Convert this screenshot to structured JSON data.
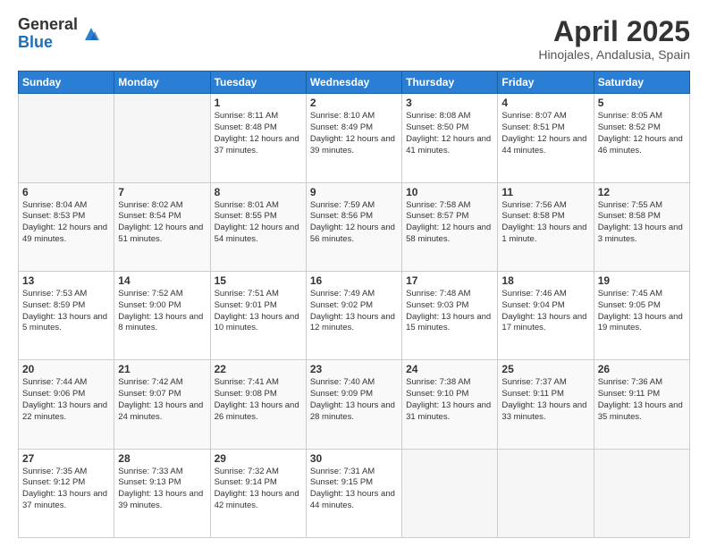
{
  "logo": {
    "general": "General",
    "blue": "Blue"
  },
  "header": {
    "title": "April 2025",
    "subtitle": "Hinojales, Andalusia, Spain"
  },
  "weekdays": [
    "Sunday",
    "Monday",
    "Tuesday",
    "Wednesday",
    "Thursday",
    "Friday",
    "Saturday"
  ],
  "weeks": [
    [
      {
        "day": "",
        "content": ""
      },
      {
        "day": "",
        "content": ""
      },
      {
        "day": "1",
        "content": "Sunrise: 8:11 AM\nSunset: 8:48 PM\nDaylight: 12 hours and 37 minutes."
      },
      {
        "day": "2",
        "content": "Sunrise: 8:10 AM\nSunset: 8:49 PM\nDaylight: 12 hours and 39 minutes."
      },
      {
        "day": "3",
        "content": "Sunrise: 8:08 AM\nSunset: 8:50 PM\nDaylight: 12 hours and 41 minutes."
      },
      {
        "day": "4",
        "content": "Sunrise: 8:07 AM\nSunset: 8:51 PM\nDaylight: 12 hours and 44 minutes."
      },
      {
        "day": "5",
        "content": "Sunrise: 8:05 AM\nSunset: 8:52 PM\nDaylight: 12 hours and 46 minutes."
      }
    ],
    [
      {
        "day": "6",
        "content": "Sunrise: 8:04 AM\nSunset: 8:53 PM\nDaylight: 12 hours and 49 minutes."
      },
      {
        "day": "7",
        "content": "Sunrise: 8:02 AM\nSunset: 8:54 PM\nDaylight: 12 hours and 51 minutes."
      },
      {
        "day": "8",
        "content": "Sunrise: 8:01 AM\nSunset: 8:55 PM\nDaylight: 12 hours and 54 minutes."
      },
      {
        "day": "9",
        "content": "Sunrise: 7:59 AM\nSunset: 8:56 PM\nDaylight: 12 hours and 56 minutes."
      },
      {
        "day": "10",
        "content": "Sunrise: 7:58 AM\nSunset: 8:57 PM\nDaylight: 12 hours and 58 minutes."
      },
      {
        "day": "11",
        "content": "Sunrise: 7:56 AM\nSunset: 8:58 PM\nDaylight: 13 hours and 1 minute."
      },
      {
        "day": "12",
        "content": "Sunrise: 7:55 AM\nSunset: 8:58 PM\nDaylight: 13 hours and 3 minutes."
      }
    ],
    [
      {
        "day": "13",
        "content": "Sunrise: 7:53 AM\nSunset: 8:59 PM\nDaylight: 13 hours and 5 minutes."
      },
      {
        "day": "14",
        "content": "Sunrise: 7:52 AM\nSunset: 9:00 PM\nDaylight: 13 hours and 8 minutes."
      },
      {
        "day": "15",
        "content": "Sunrise: 7:51 AM\nSunset: 9:01 PM\nDaylight: 13 hours and 10 minutes."
      },
      {
        "day": "16",
        "content": "Sunrise: 7:49 AM\nSunset: 9:02 PM\nDaylight: 13 hours and 12 minutes."
      },
      {
        "day": "17",
        "content": "Sunrise: 7:48 AM\nSunset: 9:03 PM\nDaylight: 13 hours and 15 minutes."
      },
      {
        "day": "18",
        "content": "Sunrise: 7:46 AM\nSunset: 9:04 PM\nDaylight: 13 hours and 17 minutes."
      },
      {
        "day": "19",
        "content": "Sunrise: 7:45 AM\nSunset: 9:05 PM\nDaylight: 13 hours and 19 minutes."
      }
    ],
    [
      {
        "day": "20",
        "content": "Sunrise: 7:44 AM\nSunset: 9:06 PM\nDaylight: 13 hours and 22 minutes."
      },
      {
        "day": "21",
        "content": "Sunrise: 7:42 AM\nSunset: 9:07 PM\nDaylight: 13 hours and 24 minutes."
      },
      {
        "day": "22",
        "content": "Sunrise: 7:41 AM\nSunset: 9:08 PM\nDaylight: 13 hours and 26 minutes."
      },
      {
        "day": "23",
        "content": "Sunrise: 7:40 AM\nSunset: 9:09 PM\nDaylight: 13 hours and 28 minutes."
      },
      {
        "day": "24",
        "content": "Sunrise: 7:38 AM\nSunset: 9:10 PM\nDaylight: 13 hours and 31 minutes."
      },
      {
        "day": "25",
        "content": "Sunrise: 7:37 AM\nSunset: 9:11 PM\nDaylight: 13 hours and 33 minutes."
      },
      {
        "day": "26",
        "content": "Sunrise: 7:36 AM\nSunset: 9:11 PM\nDaylight: 13 hours and 35 minutes."
      }
    ],
    [
      {
        "day": "27",
        "content": "Sunrise: 7:35 AM\nSunset: 9:12 PM\nDaylight: 13 hours and 37 minutes."
      },
      {
        "day": "28",
        "content": "Sunrise: 7:33 AM\nSunset: 9:13 PM\nDaylight: 13 hours and 39 minutes."
      },
      {
        "day": "29",
        "content": "Sunrise: 7:32 AM\nSunset: 9:14 PM\nDaylight: 13 hours and 42 minutes."
      },
      {
        "day": "30",
        "content": "Sunrise: 7:31 AM\nSunset: 9:15 PM\nDaylight: 13 hours and 44 minutes."
      },
      {
        "day": "",
        "content": ""
      },
      {
        "day": "",
        "content": ""
      },
      {
        "day": "",
        "content": ""
      }
    ]
  ]
}
